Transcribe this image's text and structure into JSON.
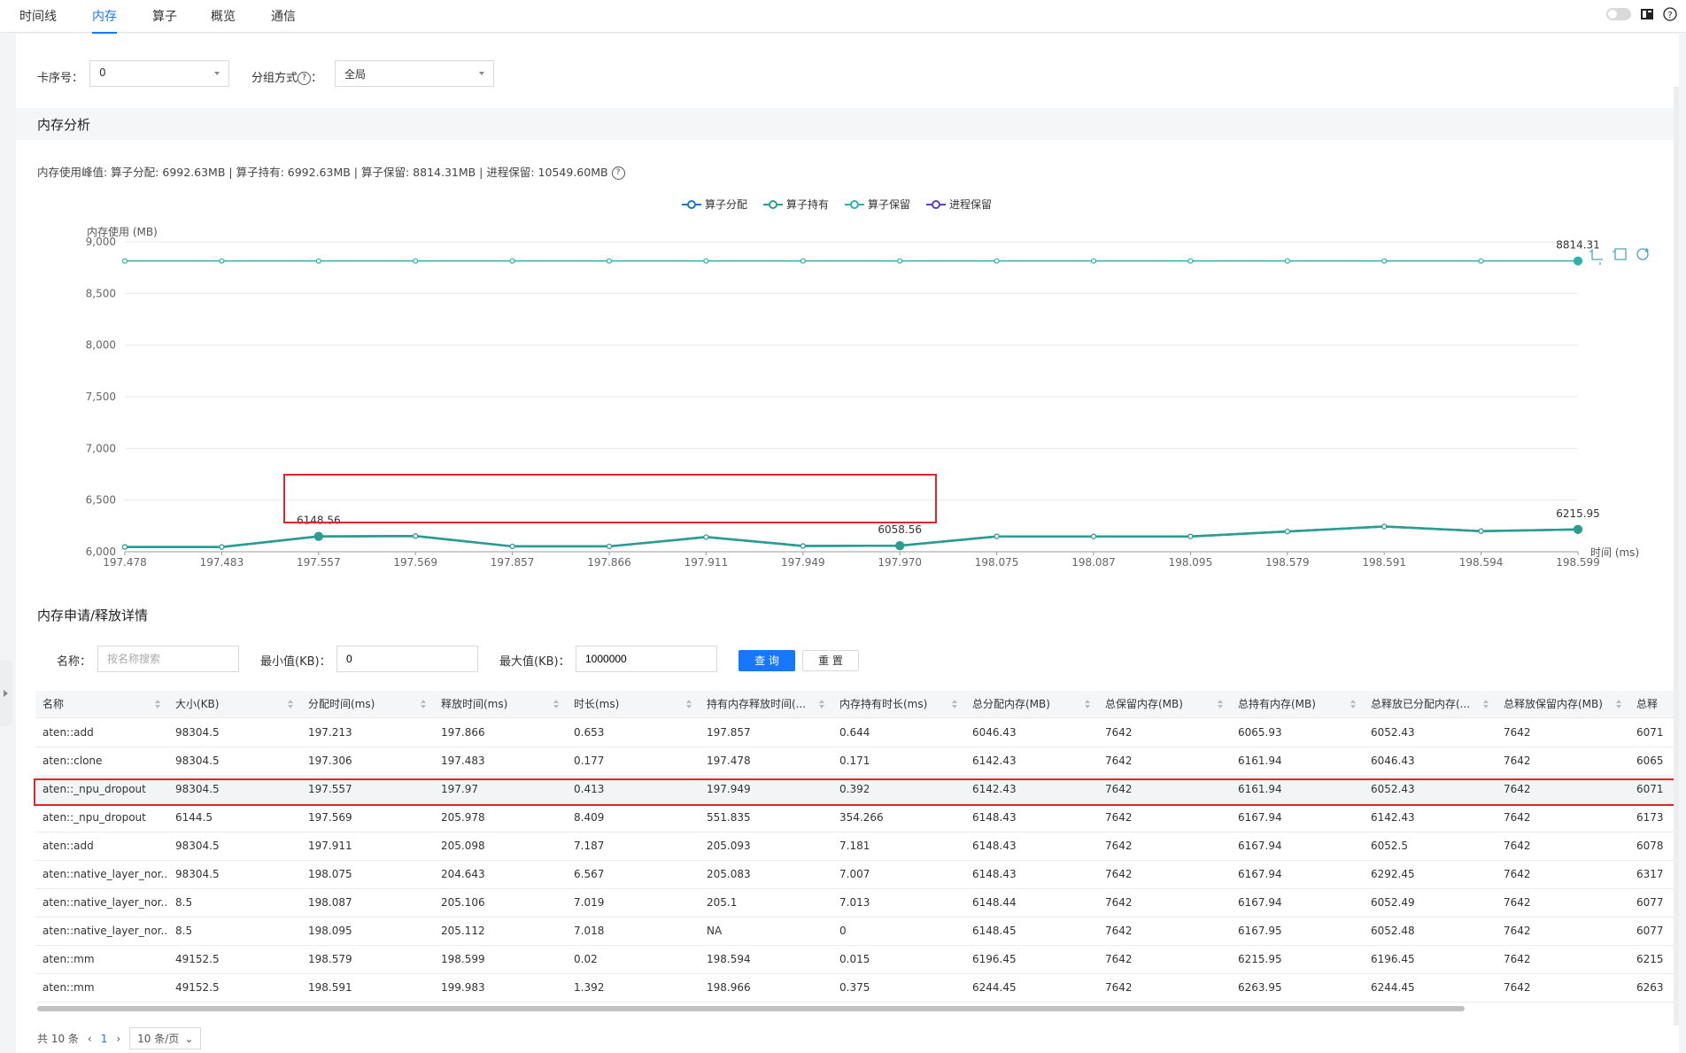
{
  "tabs": [
    {
      "label": "时间线"
    },
    {
      "label": "内存"
    },
    {
      "label": "算子"
    },
    {
      "label": "概览"
    },
    {
      "label": "通信"
    }
  ],
  "filters": {
    "card_label": "卡序号：",
    "card_value": "0",
    "group_label": "分组方式",
    "group_colon": "：",
    "group_value": "全局"
  },
  "analysis": {
    "title": "内存分析",
    "peak_text": "内存使用峰值: 算子分配: 6992.63MB | 算子持有: 6992.63MB | 算子保留: 8814.31MB | 进程保留: 10549.60MB"
  },
  "chart_data": {
    "type": "line",
    "ylabel": "内存使用 (MB)",
    "xlabel": "时间 (ms)",
    "ylim": [
      6000,
      9000
    ],
    "yticks": [
      "6,000",
      "6,500",
      "7,000",
      "7,500",
      "8,000",
      "8,500",
      "9,000"
    ],
    "categories": [
      "197.478",
      "197.483",
      "197.557",
      "197.569",
      "197.857",
      "197.866",
      "197.911",
      "197.949",
      "197.970",
      "198.075",
      "198.087",
      "198.095",
      "198.579",
      "198.591",
      "198.594",
      "198.599"
    ],
    "series": [
      {
        "name": "算子分配",
        "color": "#1a73d6",
        "values": [
          6046,
          6046,
          6148.56,
          6152,
          6052,
          6052,
          6142,
          6056,
          6058.56,
          6148,
          6148,
          6148,
          6196,
          6244,
          6199,
          6215.95
        ]
      },
      {
        "name": "算子持有",
        "color": "#2a9d8f",
        "values": [
          6046,
          6046,
          6148.56,
          6152,
          6052,
          6052,
          6142,
          6056,
          6058.56,
          6148,
          6148,
          6148,
          6196,
          6244,
          6199,
          6215.95
        ]
      },
      {
        "name": "算子保留",
        "color": "#2ab3a6",
        "values": [
          8814.31,
          8814.31,
          8814.31,
          8814.31,
          8814.31,
          8814.31,
          8814.31,
          8814.31,
          8814.31,
          8814.31,
          8814.31,
          8814.31,
          8814.31,
          8814.31,
          8814.31,
          8814.31
        ]
      },
      {
        "name": "进程保留",
        "color": "#5b3fc4",
        "values": []
      }
    ],
    "annotations": [
      {
        "category_index": 2,
        "text": "6148.56"
      },
      {
        "category_index": 8,
        "text": "6058.56"
      },
      {
        "category_index": 15,
        "text": "6215.95"
      },
      {
        "category_index": 15,
        "text": "8814.31"
      }
    ],
    "grid": true,
    "legend": "top-center"
  },
  "details": {
    "title": "内存申请/释放详情",
    "name_label": "名称：",
    "name_placeholder": "按名称搜索",
    "min_label": "最小值(KB)：",
    "min_value": "0",
    "max_label": "最大值(KB)：",
    "max_value": "1000000",
    "query_btn": "查 询",
    "reset_btn": "重 置"
  },
  "table": {
    "columns": [
      "名称",
      "大小(KB)",
      "分配时间(ms)",
      "释放时间(ms)",
      "时长(ms)",
      "持有内存释放时间(...",
      "内存持有时长(ms)",
      "总分配内存(MB)",
      "总保留内存(MB)",
      "总持有内存(MB)",
      "总释放已分配内存(...",
      "总释放保留内存(MB)",
      "总释"
    ],
    "rows": [
      [
        "aten::add",
        "98304.5",
        "197.213",
        "197.866",
        "0.653",
        "197.857",
        "0.644",
        "6046.43",
        "7642",
        "6065.93",
        "6052.43",
        "7642",
        "6071"
      ],
      [
        "aten::clone",
        "98304.5",
        "197.306",
        "197.483",
        "0.177",
        "197.478",
        "0.171",
        "6142.43",
        "7642",
        "6161.94",
        "6046.43",
        "7642",
        "6065"
      ],
      [
        "aten::_npu_dropout",
        "98304.5",
        "197.557",
        "197.97",
        "0.413",
        "197.949",
        "0.392",
        "6142.43",
        "7642",
        "6161.94",
        "6052.43",
        "7642",
        "6071"
      ],
      [
        "aten::_npu_dropout",
        "6144.5",
        "197.569",
        "205.978",
        "8.409",
        "551.835",
        "354.266",
        "6148.43",
        "7642",
        "6167.94",
        "6142.43",
        "7642",
        "6173"
      ],
      [
        "aten::add",
        "98304.5",
        "197.911",
        "205.098",
        "7.187",
        "205.093",
        "7.181",
        "6148.43",
        "7642",
        "6167.94",
        "6052.5",
        "7642",
        "6078"
      ],
      [
        "aten::native_layer_nor...",
        "98304.5",
        "198.075",
        "204.643",
        "6.567",
        "205.083",
        "7.007",
        "6148.43",
        "7642",
        "6167.94",
        "6292.45",
        "7642",
        "6317"
      ],
      [
        "aten::native_layer_nor...",
        "8.5",
        "198.087",
        "205.106",
        "7.019",
        "205.1",
        "7.013",
        "6148.44",
        "7642",
        "6167.94",
        "6052.49",
        "7642",
        "6077"
      ],
      [
        "aten::native_layer_nor...",
        "8.5",
        "198.095",
        "205.112",
        "7.018",
        "NA",
        "0",
        "6148.45",
        "7642",
        "6167.95",
        "6052.48",
        "7642",
        "6077"
      ],
      [
        "aten::mm",
        "49152.5",
        "198.579",
        "198.599",
        "0.02",
        "198.594",
        "0.015",
        "6196.45",
        "7642",
        "6215.95",
        "6196.45",
        "7642",
        "6215"
      ],
      [
        "aten::mm",
        "49152.5",
        "198.591",
        "199.983",
        "1.392",
        "198.966",
        "0.375",
        "6244.45",
        "7642",
        "6263.95",
        "6244.45",
        "7642",
        "6263"
      ]
    ]
  },
  "pager": {
    "total": "共 10 条",
    "page": "1",
    "page_size": "10 条/页"
  },
  "icons": [
    "toggle-icon",
    "book-icon",
    "help-icon",
    "zoom-icon",
    "zoom-reset-icon",
    "restore-icon"
  ]
}
